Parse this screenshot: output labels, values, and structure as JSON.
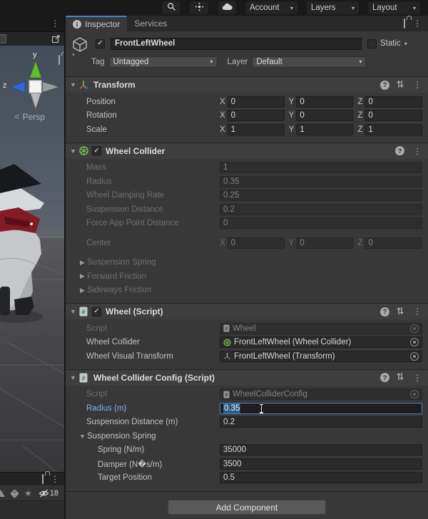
{
  "icons": {
    "kebab": "⋮",
    "help": "?",
    "check": "✓",
    "fold_open": "▼",
    "fold_closed": "▶",
    "dropdown_arrow": "▾",
    "star": "★",
    "persp_arrow": "<",
    "info": "i"
  },
  "topbar": {
    "account": "Account",
    "layers": "Layers",
    "layout": "Layout"
  },
  "tabbar": {
    "inspector": "Inspector",
    "services": "Services"
  },
  "scene": {
    "axis_y": "y",
    "axis_z": "z",
    "persp": "Persp",
    "hidden_count": "18"
  },
  "gameobject": {
    "name": "FrontLeftWheel",
    "static_label": "Static",
    "tag_label": "Tag",
    "tag_value": "Untagged",
    "layer_label": "Layer",
    "layer_value": "Default"
  },
  "axes": {
    "x": "X",
    "y": "Y",
    "z": "Z"
  },
  "transform": {
    "title": "Transform",
    "position_label": "Position",
    "position": {
      "x": "0",
      "y": "0",
      "z": "0"
    },
    "rotation_label": "Rotation",
    "rotation": {
      "x": "0",
      "y": "0",
      "z": "0"
    },
    "scale_label": "Scale",
    "scale": {
      "x": "1",
      "y": "1",
      "z": "1"
    }
  },
  "wheel_collider": {
    "title": "Wheel Collider",
    "mass_label": "Mass",
    "mass": "1",
    "radius_label": "Radius",
    "radius": "0.35",
    "damping_label": "Wheel Damping Rate",
    "damping": "0.25",
    "suspension_label": "Suspension Distance",
    "suspension": "0.2",
    "force_label": "Force App Point Distance",
    "force": "0",
    "center_label": "Center",
    "center": {
      "x": "0",
      "y": "0",
      "z": "0"
    },
    "foldout_spring": "Suspension Spring",
    "foldout_forward": "Forward Friction",
    "foldout_sideways": "Sideways Friction"
  },
  "wheel_script": {
    "title": "Wheel (Script)",
    "script_label": "Script",
    "script_value": "Wheel",
    "collider_label": "Wheel Collider",
    "collider_value": "FrontLeftWheel (Wheel Collider)",
    "visual_label": "Wheel Visual Transform",
    "visual_value": "FrontLeftWheel (Transform)"
  },
  "config": {
    "title": "Wheel Collider Config (Script)",
    "script_label": "Script",
    "script_value": "WheelColliderConfig",
    "radius_label": "Radius (m)",
    "radius_value": "0.35",
    "suspension_label": "Suspension Distance (m)",
    "suspension_value": "0.2",
    "spring_foldout": "Suspension Spring",
    "spring_label": "Spring (N/m)",
    "spring_value": "35000",
    "damper_label": "Damper (N�s/m)",
    "damper_value": "3500",
    "target_label": "Target Position",
    "target_value": "0.5"
  },
  "footer": {
    "add_component": "Add Component"
  },
  "colors": {
    "accent_blue": "#4b7fc4",
    "selection_blue": "#2c5d87",
    "label_blue": "#7fb2e6",
    "panel_bg": "#383838",
    "header_bg": "#3e3e3e",
    "field_bg": "#2a2a2a",
    "topbar_bg": "#191919"
  }
}
